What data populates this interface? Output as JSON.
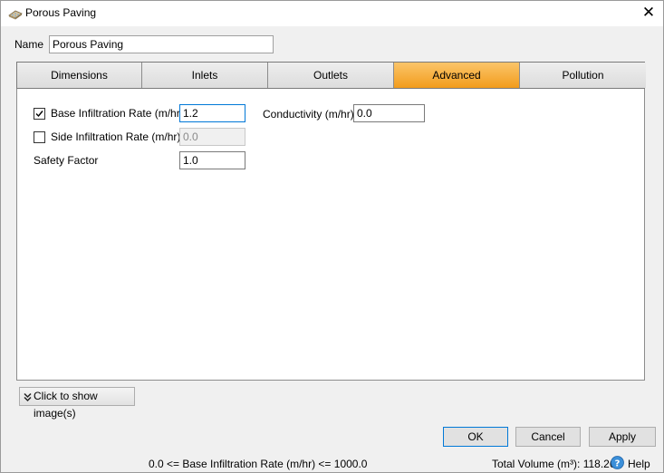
{
  "window": {
    "title": "Porous Paving",
    "icon": "porous-paving-icon",
    "close_glyph": "✕"
  },
  "name_field": {
    "label": "Name",
    "value": "Porous Paving"
  },
  "tabs": [
    {
      "label": "Dimensions",
      "active": false
    },
    {
      "label": "Inlets",
      "active": false
    },
    {
      "label": "Outlets",
      "active": false
    },
    {
      "label": "Advanced",
      "active": true
    },
    {
      "label": "Pollution",
      "active": false
    }
  ],
  "advanced": {
    "base_infiltration": {
      "label": "Base Infiltration Rate (m/hr)",
      "checked": true,
      "value": "1.2"
    },
    "side_infiltration": {
      "label": "Side Infiltration Rate (m/hr)",
      "checked": false,
      "value": "0.0"
    },
    "safety_factor": {
      "label": "Safety Factor",
      "value": "1.0"
    },
    "conductivity": {
      "label": "Conductivity (m/hr)",
      "value": "0.0"
    }
  },
  "show_images_button": "Click to show image(s)",
  "buttons": {
    "ok": "OK",
    "cancel": "Cancel",
    "apply": "Apply"
  },
  "status": {
    "rule": "0.0 <= Base Infiltration Rate (m/hr) <= 1000.0",
    "total_volume": "Total Volume (m³): 118.263",
    "help": "Help"
  },
  "colors": {
    "active_tab": "#f29c1c",
    "focus_border": "#0078d7"
  }
}
